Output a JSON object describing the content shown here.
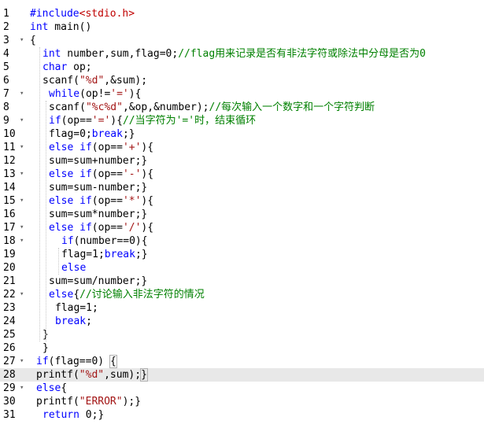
{
  "editor": {
    "active_line": 28,
    "lines": [
      {
        "n": "1",
        "fold": "",
        "indent": 0,
        "tokens": [
          {
            "t": "#include",
            "c": "pp"
          },
          {
            "t": "<stdio.h>",
            "c": "ppv"
          }
        ]
      },
      {
        "n": "2",
        "fold": "",
        "indent": 0,
        "tokens": [
          {
            "t": "int",
            "c": "kw"
          },
          {
            "t": " main()",
            "c": "p"
          }
        ]
      },
      {
        "n": "3",
        "fold": "▾",
        "indent": 0,
        "tokens": [
          {
            "t": "{",
            "c": "p"
          }
        ]
      },
      {
        "n": "4",
        "fold": "",
        "indent": 2,
        "tokens": [
          {
            "t": "int",
            "c": "kw"
          },
          {
            "t": " number,sum,flag=0;",
            "c": "p"
          },
          {
            "t": "//flag用来记录是否有非法字符或除法中分母是否为0",
            "c": "com"
          }
        ]
      },
      {
        "n": "5",
        "fold": "",
        "indent": 2,
        "tokens": [
          {
            "t": "char",
            "c": "kw"
          },
          {
            "t": " op;",
            "c": "p"
          }
        ]
      },
      {
        "n": "6",
        "fold": "",
        "indent": 2,
        "tokens": [
          {
            "t": "scanf(",
            "c": "p"
          },
          {
            "t": "\"%d\"",
            "c": "str"
          },
          {
            "t": ",&sum);",
            "c": "p"
          }
        ]
      },
      {
        "n": "7",
        "fold": "▾",
        "indent": 3,
        "tokens": [
          {
            "t": "while",
            "c": "kw"
          },
          {
            "t": "(op!=",
            "c": "p"
          },
          {
            "t": "'='",
            "c": "str"
          },
          {
            "t": "){",
            "c": "p"
          }
        ]
      },
      {
        "n": "8",
        "fold": "",
        "indent": 3,
        "tokens": [
          {
            "t": "scanf(",
            "c": "p"
          },
          {
            "t": "\"%c%d\"",
            "c": "str"
          },
          {
            "t": ",&op,&number);",
            "c": "p"
          },
          {
            "t": "//每次输入一个数字和一个字符判断",
            "c": "com"
          }
        ]
      },
      {
        "n": "9",
        "fold": "▾",
        "indent": 3,
        "tokens": [
          {
            "t": "if",
            "c": "kw"
          },
          {
            "t": "(op==",
            "c": "p"
          },
          {
            "t": "'='",
            "c": "str"
          },
          {
            "t": "){",
            "c": "p"
          },
          {
            "t": "//当字符为'='时，结束循环",
            "c": "com"
          }
        ]
      },
      {
        "n": "10",
        "fold": "",
        "indent": 3,
        "tokens": [
          {
            "t": "flag=0;",
            "c": "p"
          },
          {
            "t": "break",
            "c": "kw"
          },
          {
            "t": ";}",
            "c": "p"
          }
        ]
      },
      {
        "n": "11",
        "fold": "▾",
        "indent": 3,
        "tokens": [
          {
            "t": "else if",
            "c": "kw"
          },
          {
            "t": "(op==",
            "c": "p"
          },
          {
            "t": "'+'",
            "c": "str"
          },
          {
            "t": "){",
            "c": "p"
          }
        ]
      },
      {
        "n": "12",
        "fold": "",
        "indent": 3,
        "tokens": [
          {
            "t": "sum=sum+number;}",
            "c": "p"
          }
        ]
      },
      {
        "n": "13",
        "fold": "▾",
        "indent": 3,
        "tokens": [
          {
            "t": "else if",
            "c": "kw"
          },
          {
            "t": "(op==",
            "c": "p"
          },
          {
            "t": "'-'",
            "c": "str"
          },
          {
            "t": "){",
            "c": "p"
          }
        ]
      },
      {
        "n": "14",
        "fold": "",
        "indent": 3,
        "tokens": [
          {
            "t": "sum=sum-number;}",
            "c": "p"
          }
        ]
      },
      {
        "n": "15",
        "fold": "▾",
        "indent": 3,
        "tokens": [
          {
            "t": "else if",
            "c": "kw"
          },
          {
            "t": "(op==",
            "c": "p"
          },
          {
            "t": "'*'",
            "c": "str"
          },
          {
            "t": "){",
            "c": "p"
          }
        ]
      },
      {
        "n": "16",
        "fold": "",
        "indent": 3,
        "tokens": [
          {
            "t": "sum=sum*number;}",
            "c": "p"
          }
        ]
      },
      {
        "n": "17",
        "fold": "▾",
        "indent": 3,
        "tokens": [
          {
            "t": "else if",
            "c": "kw"
          },
          {
            "t": "(op==",
            "c": "p"
          },
          {
            "t": "'/'",
            "c": "str"
          },
          {
            "t": "){",
            "c": "p"
          }
        ]
      },
      {
        "n": "18",
        "fold": "▾",
        "indent": 5,
        "tokens": [
          {
            "t": "if",
            "c": "kw"
          },
          {
            "t": "(number==0){",
            "c": "p"
          }
        ]
      },
      {
        "n": "19",
        "fold": "",
        "indent": 5,
        "tokens": [
          {
            "t": "flag=1;",
            "c": "p"
          },
          {
            "t": "break",
            "c": "kw"
          },
          {
            "t": ";}",
            "c": "p"
          }
        ]
      },
      {
        "n": "20",
        "fold": "",
        "indent": 5,
        "tokens": [
          {
            "t": "else",
            "c": "kw"
          }
        ]
      },
      {
        "n": "21",
        "fold": "",
        "indent": 3,
        "tokens": [
          {
            "t": "sum=sum/number;}",
            "c": "p"
          }
        ]
      },
      {
        "n": "22",
        "fold": "▾",
        "indent": 3,
        "tokens": [
          {
            "t": "else",
            "c": "kw"
          },
          {
            "t": "{",
            "c": "p"
          },
          {
            "t": "//讨论输入非法字符的情况",
            "c": "com"
          }
        ]
      },
      {
        "n": "23",
        "fold": "",
        "indent": 4,
        "tokens": [
          {
            "t": "flag=1;",
            "c": "p"
          }
        ]
      },
      {
        "n": "24",
        "fold": "",
        "indent": 4,
        "tokens": [
          {
            "t": "break",
            "c": "kw"
          },
          {
            "t": ";",
            "c": "p"
          }
        ]
      },
      {
        "n": "25",
        "fold": "",
        "indent": 2,
        "tokens": [
          {
            "t": "}",
            "c": "p"
          }
        ]
      },
      {
        "n": "26",
        "fold": "",
        "indent": 2,
        "tokens": [
          {
            "t": "}",
            "c": "p"
          }
        ]
      },
      {
        "n": "27",
        "fold": "▾",
        "indent": 1,
        "tokens": [
          {
            "t": "if",
            "c": "kw"
          },
          {
            "t": "(flag==0) ",
            "c": "p"
          },
          {
            "t": "{",
            "c": "p",
            "box": true
          }
        ]
      },
      {
        "n": "28",
        "fold": "",
        "indent": 1,
        "tokens": [
          {
            "t": "printf(",
            "c": "p"
          },
          {
            "t": "\"%d\"",
            "c": "str"
          },
          {
            "t": ",sum);",
            "c": "p"
          },
          {
            "t": "}",
            "c": "p",
            "box": true,
            "caret": true
          }
        ]
      },
      {
        "n": "29",
        "fold": "▾",
        "indent": 1,
        "tokens": [
          {
            "t": "else",
            "c": "kw"
          },
          {
            "t": "{",
            "c": "p"
          }
        ]
      },
      {
        "n": "30",
        "fold": "",
        "indent": 1,
        "tokens": [
          {
            "t": "printf(",
            "c": "p"
          },
          {
            "t": "\"ERROR\"",
            "c": "str"
          },
          {
            "t": ");}",
            "c": "p"
          }
        ]
      },
      {
        "n": "31",
        "fold": "",
        "indent": 2,
        "tokens": [
          {
            "t": "return",
            "c": "kw"
          },
          {
            "t": " 0;}",
            "c": "p"
          }
        ]
      }
    ]
  }
}
